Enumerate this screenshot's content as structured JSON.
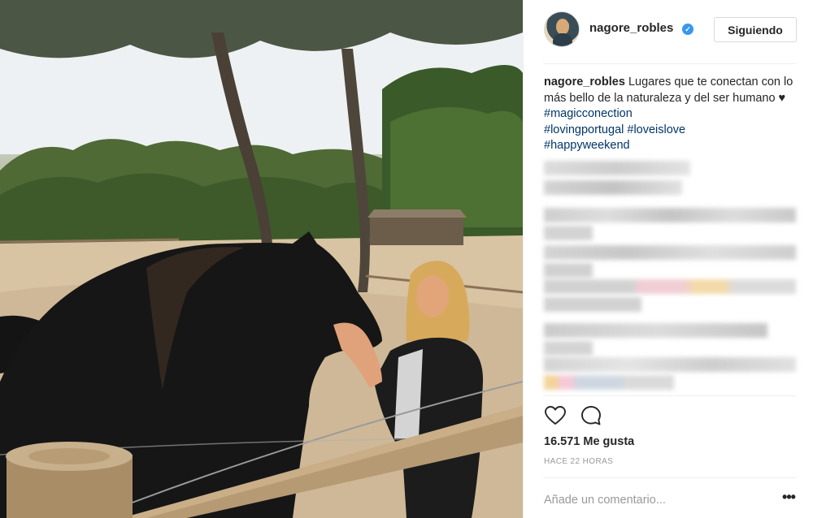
{
  "post": {
    "username": "nagore_robles",
    "follow_label": "Siguiendo",
    "caption": {
      "username": "nagore_robles",
      "text": "Lugares que te conectan con lo más bello de la naturaleza y del ser humano ♥",
      "hashtags": [
        "#magicconection",
        "#lovingportugal",
        "#loveislove",
        "#happyweekend"
      ]
    },
    "likes_text": "16.571 Me gusta",
    "timestamp": "HACE 22 HORAS",
    "comment_placeholder": "Añade un comentario...",
    "more_options": "•••"
  },
  "icons": {
    "verified": "verified-badge-icon",
    "like": "heart-outline-icon",
    "comment": "speech-bubble-icon",
    "more": "ellipsis-icon"
  },
  "colors": {
    "hashtag": "#003569",
    "verified": "#3897f0",
    "secondary_text": "#999999",
    "border": "#dbdbdb"
  }
}
